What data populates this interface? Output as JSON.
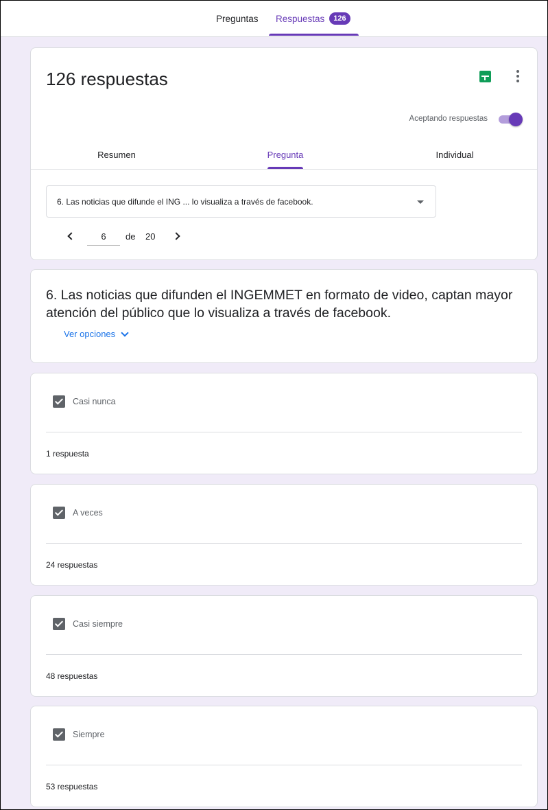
{
  "top_tabs": {
    "questions_label": "Preguntas",
    "responses_label": "Respuestas",
    "responses_badge": "126"
  },
  "summary": {
    "title": "126 respuestas",
    "accepting_label": "Aceptando respuestas",
    "accepting_on": true,
    "tabs": [
      {
        "label": "Resumen",
        "active": false
      },
      {
        "label": "Pregunta",
        "active": true
      },
      {
        "label": "Individual",
        "active": false
      }
    ],
    "question_selector": "6. Las noticias que difunde el ING ... lo visualiza a través de facebook.",
    "pager": {
      "current": "6",
      "of_label": "de",
      "total": "20"
    }
  },
  "question": {
    "title": "6. Las noticias que difunden el INGEMMET en formato de video, captan mayor atención del público que lo visualiza a través de facebook.",
    "see_options_label": "Ver opciones"
  },
  "options": [
    {
      "label": "Casi nunca",
      "checked": true,
      "count_text": "1 respuesta"
    },
    {
      "label": "A veces",
      "checked": true,
      "count_text": "24 respuestas"
    },
    {
      "label": "Casi siempre",
      "checked": true,
      "count_text": "48 respuestas"
    },
    {
      "label": "Siempre",
      "checked": true,
      "count_text": "53 respuestas"
    }
  ],
  "colors": {
    "accent": "#673ab7",
    "background": "#f0ebf8",
    "link": "#1a73e8",
    "sheets_green": "#0f9d58"
  },
  "icons": {
    "sheets": "google-sheets-icon",
    "more": "more-vert-icon",
    "dropdown": "caret-down-icon",
    "prev": "chevron-left-icon",
    "next": "chevron-right-icon",
    "see_options": "chevron-down-icon",
    "checkbox": "checkbox-checked-icon"
  }
}
